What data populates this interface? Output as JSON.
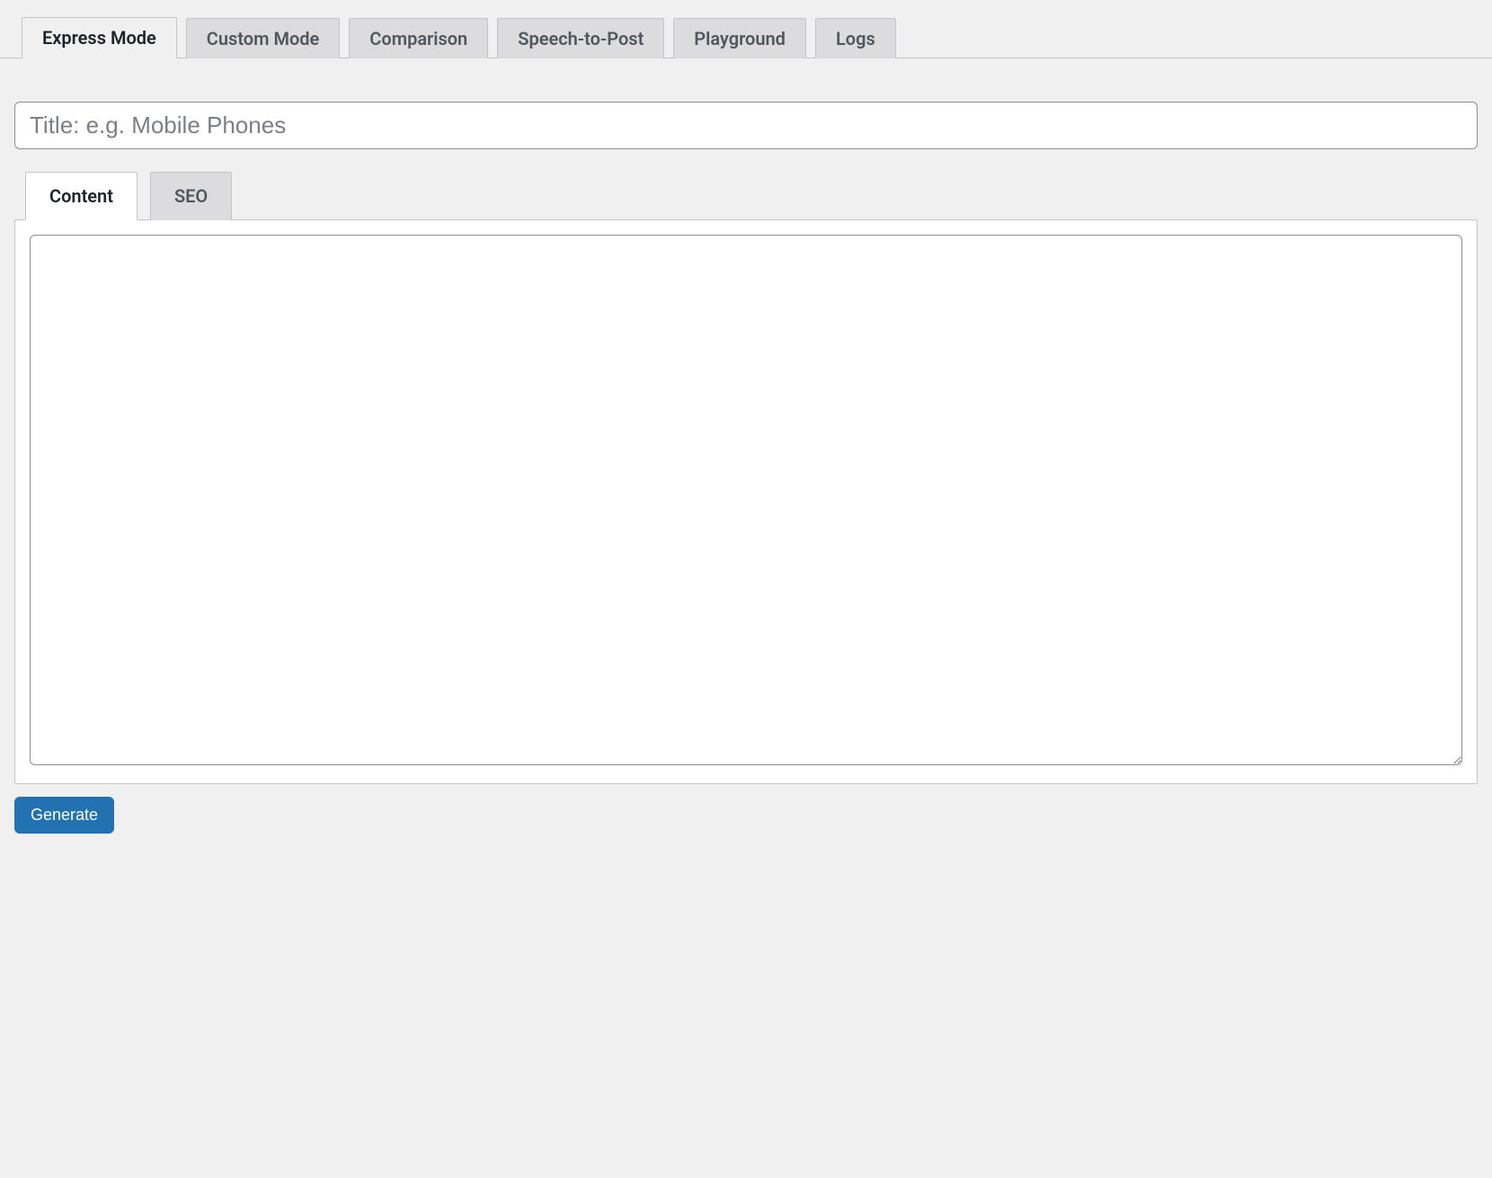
{
  "nav_tabs": [
    {
      "label": "Express Mode",
      "active": true
    },
    {
      "label": "Custom Mode",
      "active": false
    },
    {
      "label": "Comparison",
      "active": false
    },
    {
      "label": "Speech-to-Post",
      "active": false
    },
    {
      "label": "Playground",
      "active": false
    },
    {
      "label": "Logs",
      "active": false
    }
  ],
  "title_input": {
    "placeholder": "Title: e.g. Mobile Phones",
    "value": ""
  },
  "sub_tabs": [
    {
      "label": "Content",
      "active": true
    },
    {
      "label": "SEO",
      "active": false
    }
  ],
  "content_textarea": {
    "value": ""
  },
  "buttons": {
    "generate": "Generate"
  },
  "colors": {
    "page_bg": "#f0f0f1",
    "tab_bg": "#dcdcde",
    "border": "#c3c4c7",
    "text_muted": "#50575e",
    "primary": "#2271b1"
  }
}
